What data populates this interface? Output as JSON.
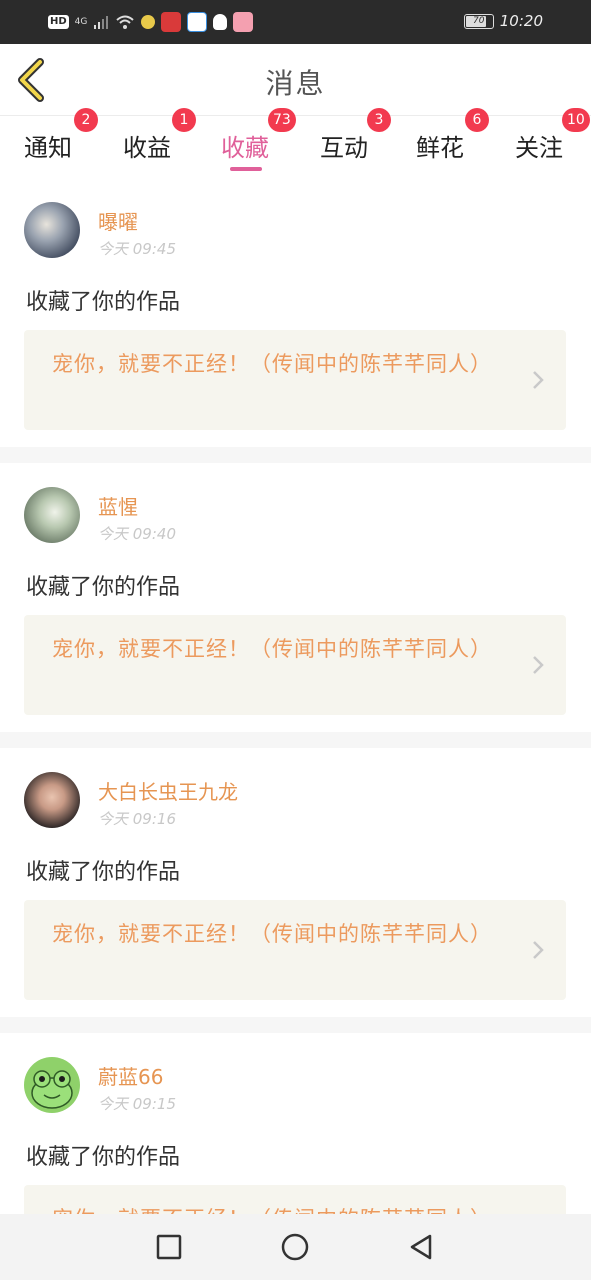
{
  "status_bar": {
    "hd": "HD",
    "signal": "4G",
    "battery": "70",
    "time": "10:20"
  },
  "header": {
    "title": "消息",
    "back_icon": "chevron-left-icon"
  },
  "tabs": [
    {
      "label": "通知",
      "badge": "2"
    },
    {
      "label": "收益",
      "badge": "1"
    },
    {
      "label": "收藏",
      "badge": "73",
      "active": true
    },
    {
      "label": "互动",
      "badge": "3"
    },
    {
      "label": "鲜花",
      "badge": "6"
    },
    {
      "label": "关注",
      "badge": "10"
    }
  ],
  "messages": [
    {
      "user": "曝曜",
      "time": "今天 09:45",
      "action": "收藏了你的作品",
      "work": "宠你，就要不正经！（传闻中的陈芊芊同人）"
    },
    {
      "user": "蓝惺",
      "time": "今天 09:40",
      "action": "收藏了你的作品",
      "work": "宠你，就要不正经！（传闻中的陈芊芊同人）"
    },
    {
      "user": "大白长虫王九龙",
      "time": "今天 09:16",
      "action": "收藏了你的作品",
      "work": "宠你，就要不正经！（传闻中的陈芊芊同人）"
    },
    {
      "user": "蔚蓝66",
      "time": "今天 09:15",
      "action": "收藏了你的作品",
      "work": "宠你，就要不正经！（传闻中的陈芊芊同人）"
    }
  ],
  "colors": {
    "accent": "#e0609a",
    "username": "#e69552",
    "work_title": "#ec9a5e",
    "badge": "#f23a4f"
  }
}
